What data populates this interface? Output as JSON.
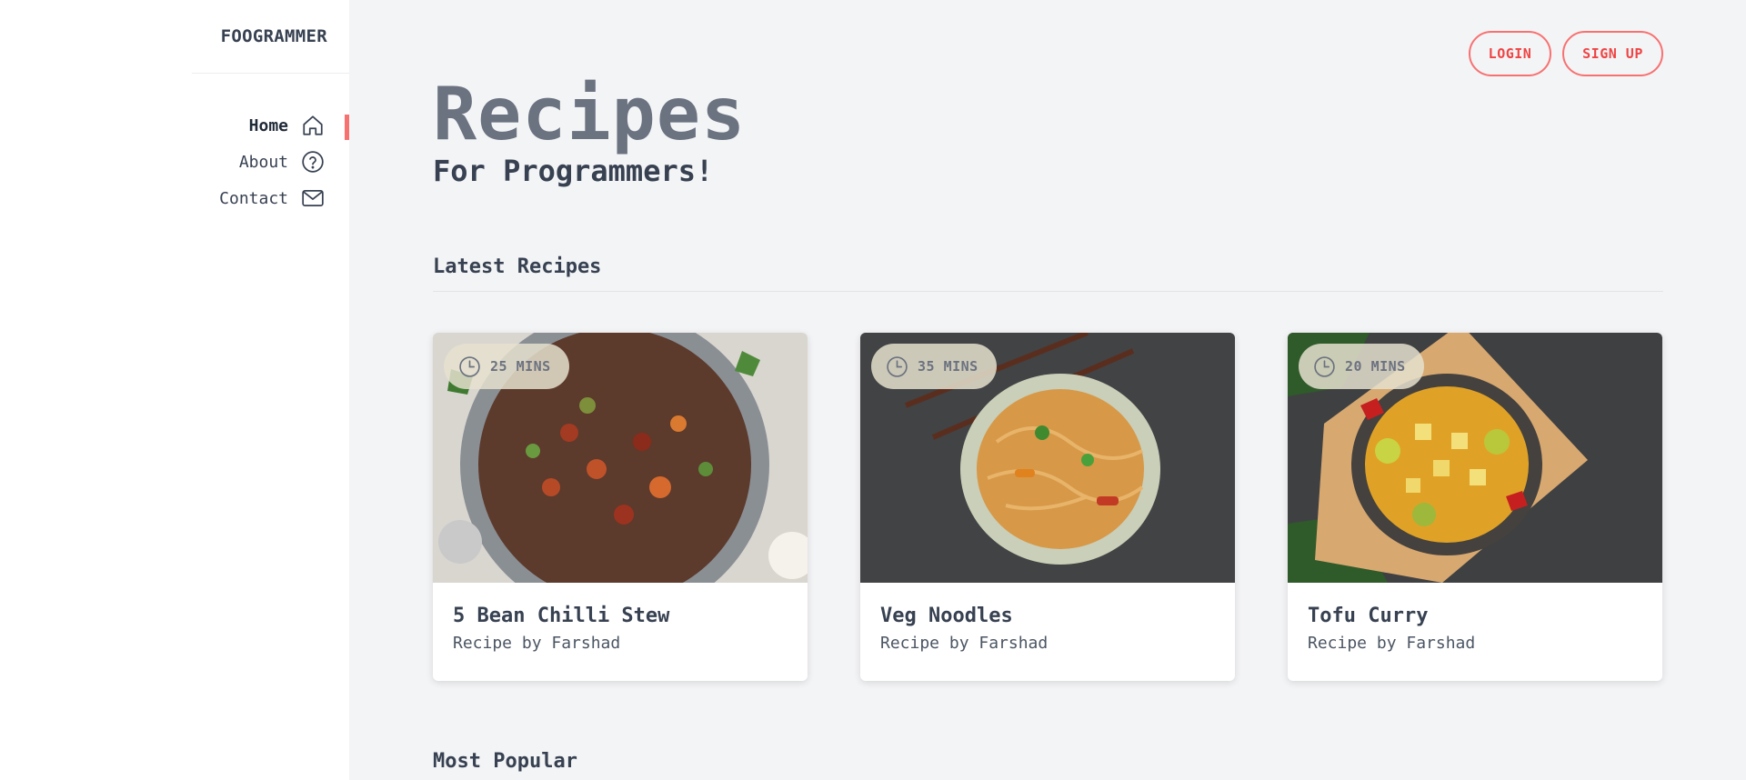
{
  "sidebar": {
    "brand": "FOOGRAMMER",
    "items": [
      {
        "label": "Home",
        "icon": "home-icon",
        "active": true
      },
      {
        "label": "About",
        "icon": "help-circle-icon",
        "active": false
      },
      {
        "label": "Contact",
        "icon": "envelope-icon",
        "active": false
      }
    ]
  },
  "header": {
    "login_label": "LOGIN",
    "signup_label": "SIGN UP"
  },
  "hero": {
    "title": "Recipes",
    "subtitle": "For Programmers!"
  },
  "latest": {
    "heading": "Latest Recipes",
    "cards": [
      {
        "time": "25 MINS",
        "title": "5 Bean Chilli Stew",
        "author": "Recipe by Farshad"
      },
      {
        "time": "35 MINS",
        "title": "Veg Noodles",
        "author": "Recipe by Farshad"
      },
      {
        "time": "20 MINS",
        "title": "Tofu Curry",
        "author": "Recipe by Farshad"
      }
    ]
  },
  "popular": {
    "heading": "Most Popular"
  },
  "colors": {
    "accent": "#f87171",
    "background": "#f3f4f6",
    "sidebar": "#ffffff"
  }
}
